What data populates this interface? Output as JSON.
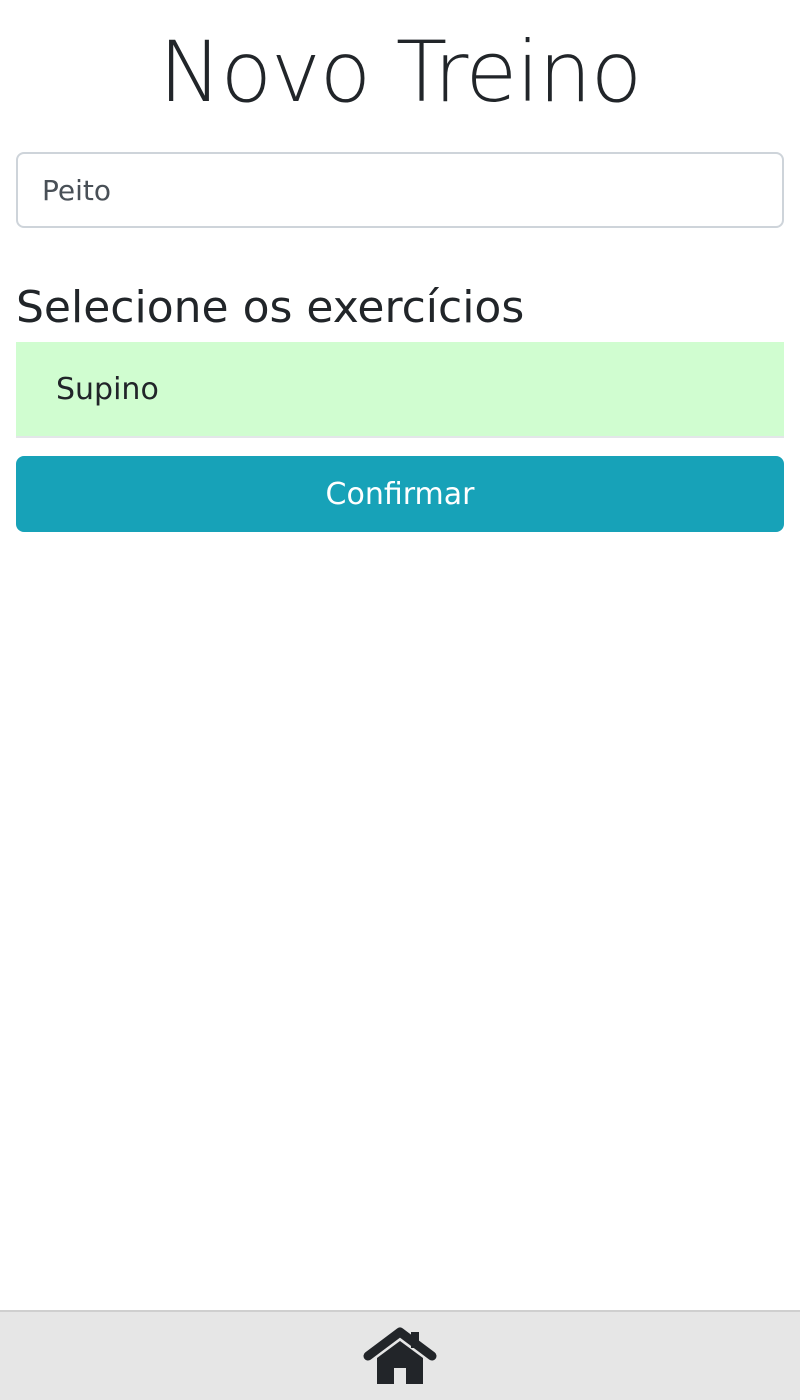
{
  "header": {
    "title": "Novo Treino"
  },
  "form": {
    "workout_name_value": "Peito"
  },
  "exercises": {
    "heading": "Selecione os exercícios",
    "items": [
      {
        "label": "Supino",
        "selected": true
      }
    ]
  },
  "actions": {
    "confirm_label": "Confirmar"
  },
  "bottom_nav": {
    "home_icon": "home-icon"
  },
  "colors": {
    "selected_item_bg": "#d0fdd0",
    "confirm_button_bg": "#17a2b8",
    "bottom_bar_bg": "#e6e6e6",
    "text": "#212529"
  }
}
